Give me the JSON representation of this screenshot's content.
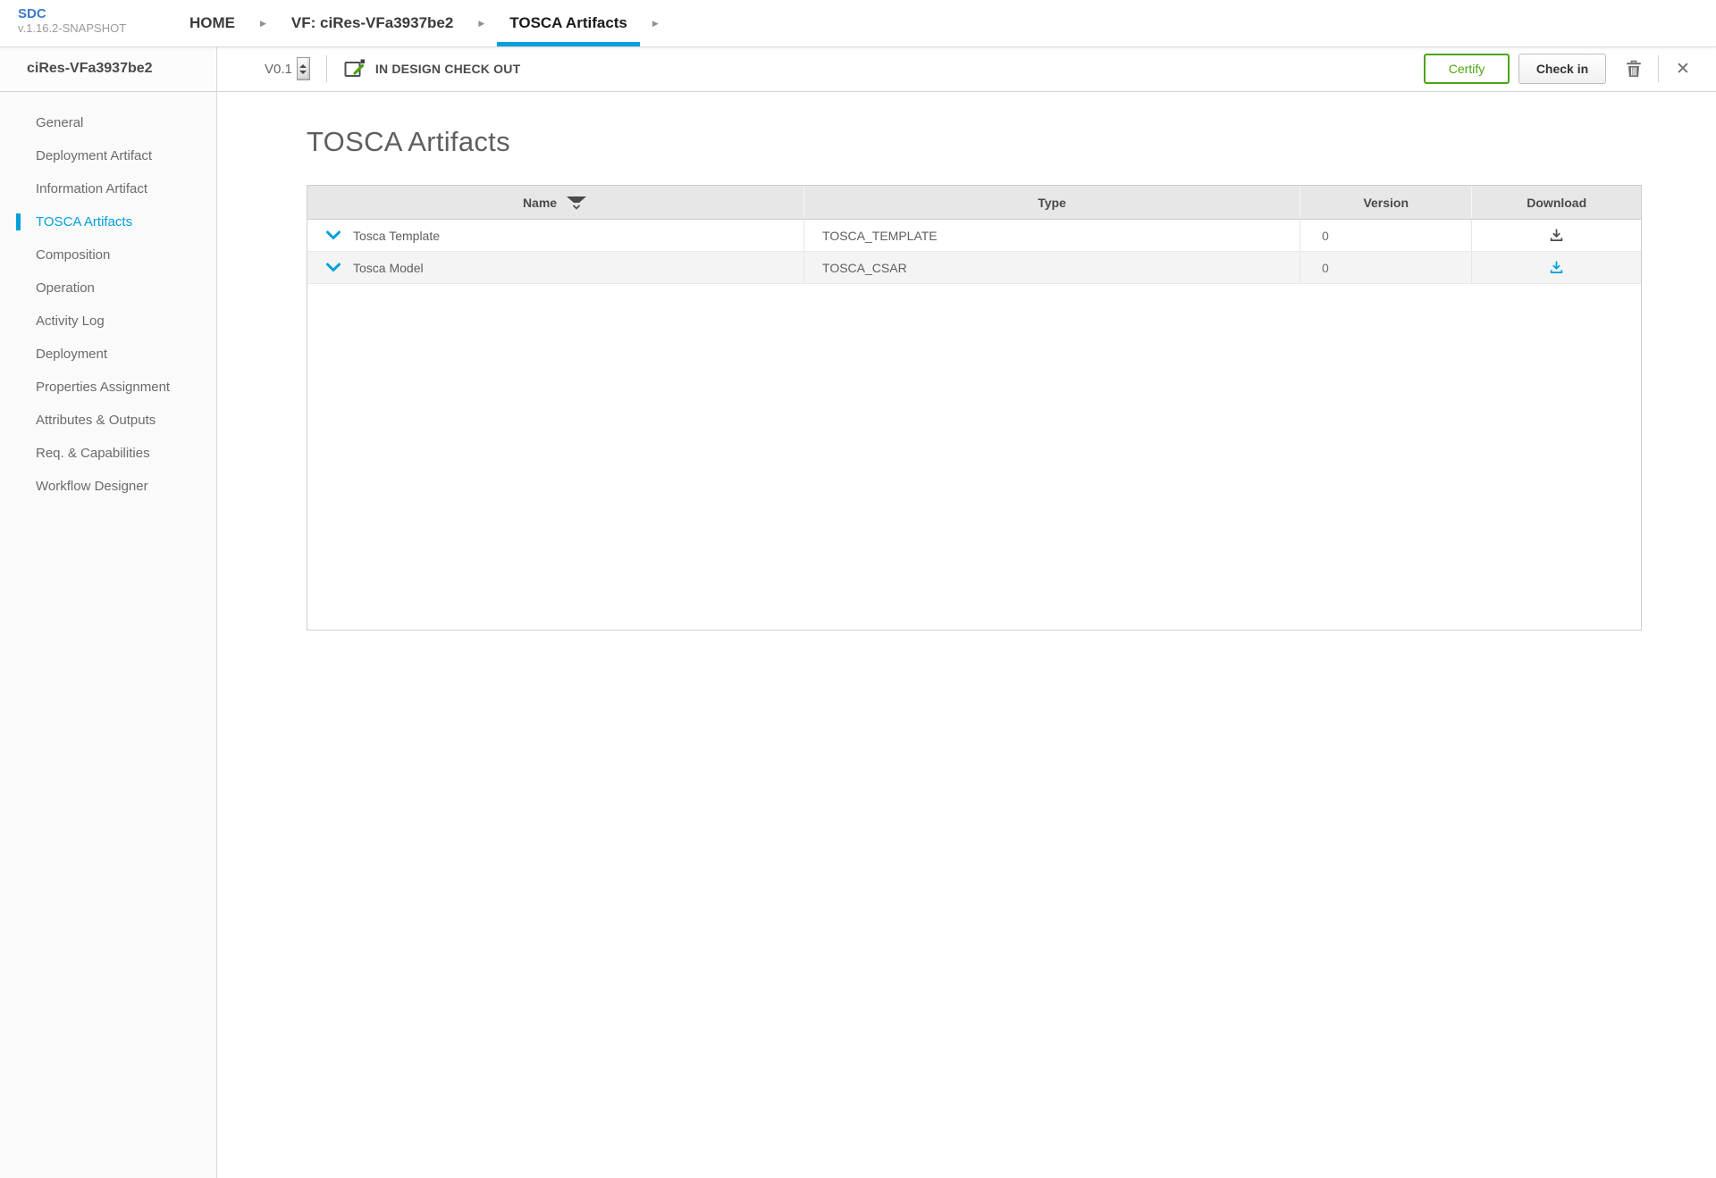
{
  "colors": {
    "accent": "#009fdb",
    "logo-blue": "#3b7cc8",
    "green": "#4ca50f"
  },
  "icons": {
    "breadcrumb_arrow": "▶",
    "close": "✕"
  },
  "header": {
    "logo": {
      "title": "SDC",
      "version": "v.1.16.2-SNAPSHOT"
    },
    "tabs": [
      {
        "label": "HOME",
        "active": false
      },
      {
        "label": "VF: ciRes-VFa3937be2",
        "active": false
      },
      {
        "label": "TOSCA Artifacts",
        "active": true
      }
    ]
  },
  "toolbar": {
    "version": "V0.1",
    "status": "IN DESIGN CHECK OUT",
    "certify_label": "Certify",
    "checkin_label": "Check in"
  },
  "sidebar": {
    "title": "ciRes-VFa3937be2",
    "items": [
      {
        "label": "General",
        "active": false
      },
      {
        "label": "Deployment Artifact",
        "active": false
      },
      {
        "label": "Information Artifact",
        "active": false
      },
      {
        "label": "TOSCA Artifacts",
        "active": true
      },
      {
        "label": "Composition",
        "active": false
      },
      {
        "label": "Operation",
        "active": false
      },
      {
        "label": "Activity Log",
        "active": false
      },
      {
        "label": "Deployment",
        "active": false
      },
      {
        "label": "Properties Assignment",
        "active": false
      },
      {
        "label": "Attributes & Outputs",
        "active": false
      },
      {
        "label": "Req. & Capabilities",
        "active": false
      },
      {
        "label": "Workflow Designer",
        "active": false
      }
    ]
  },
  "main": {
    "title": "TOSCA Artifacts",
    "table": {
      "columns": [
        "Name",
        "Type",
        "Version",
        "Download"
      ],
      "rows": [
        {
          "name": "Tosca Template",
          "type": "TOSCA_TEMPLATE",
          "version": "0",
          "download_highlighted": false
        },
        {
          "name": "Tosca Model",
          "type": "TOSCA_CSAR",
          "version": "0",
          "download_highlighted": true
        }
      ]
    }
  }
}
